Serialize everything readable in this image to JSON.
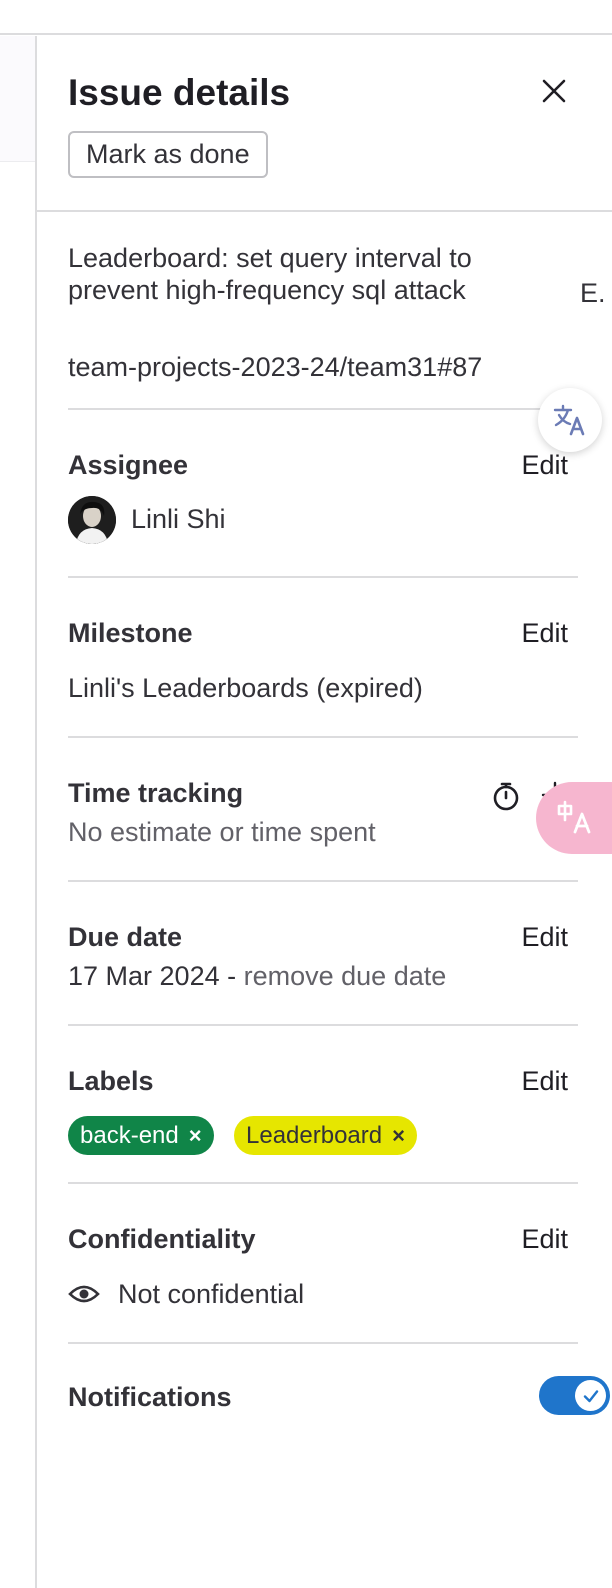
{
  "drawer": {
    "title": "Issue details",
    "mark_done_label": "Mark as done",
    "close_icon": "close-icon"
  },
  "issue": {
    "title": "Leaderboard: set query interval to prevent high-frequency sql attack",
    "reference": "team-projects-2023-24/team31#87",
    "trailing_char": "E."
  },
  "assignee": {
    "heading": "Assignee",
    "edit_label": "Edit",
    "name": "Linli Shi"
  },
  "milestone": {
    "heading": "Milestone",
    "edit_label": "Edit",
    "value": "Linli's Leaderboards (expired)"
  },
  "time_tracking": {
    "heading": "Time tracking",
    "value": "No estimate or time spent",
    "stopwatch_icon": "stopwatch-icon",
    "add_icon": "plus-icon"
  },
  "due_date": {
    "heading": "Due date",
    "edit_label": "Edit",
    "date": "17 Mar 2024",
    "separator": " - ",
    "remove_label": "remove due date"
  },
  "labels": {
    "heading": "Labels",
    "edit_label": "Edit",
    "items": [
      {
        "name": "back-end",
        "remove": "×",
        "bg": "#108548",
        "fg": "#ffffff"
      },
      {
        "name": "Leaderboard",
        "remove": "×",
        "bg": "#e6e600",
        "fg": "#333238"
      }
    ]
  },
  "confidentiality": {
    "heading": "Confidentiality",
    "edit_label": "Edit",
    "value": "Not confidential"
  },
  "notifications": {
    "heading": "Notifications",
    "enabled": true
  },
  "colors": {
    "toggle_on": "#1f75cb",
    "divider": "#dcdcde",
    "translate_pink": "#f6b6cf",
    "translate_icon": "#6b7bb5"
  }
}
